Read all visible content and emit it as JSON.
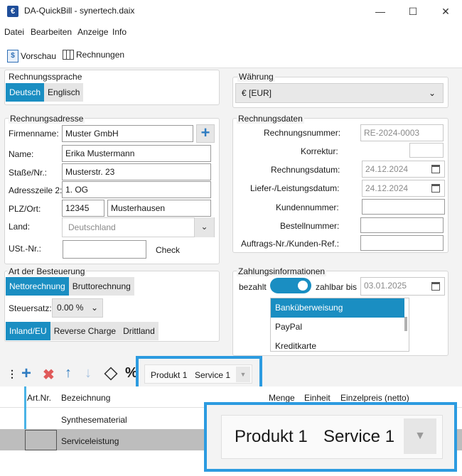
{
  "window": {
    "title": "DA-QuickBill - synertech.daix"
  },
  "menu": [
    "Datei",
    "Bearbeiten",
    "Anzeige",
    "Info"
  ],
  "toolbar": {
    "preview": "Vorschau",
    "invoices": "Rechnungen"
  },
  "language": {
    "title": "Rechnungssprache",
    "options": [
      "Deutsch",
      "Englisch"
    ],
    "selected": "Deutsch"
  },
  "currency": {
    "title": "Währung",
    "value": "€ [EUR]"
  },
  "address": {
    "title": "Rechnungsadresse",
    "company_label": "Firmenname:",
    "company": "Muster GmbH",
    "name_label": "Name:",
    "name": "Erika Mustermann",
    "street_label": "Staße/Nr.:",
    "street": "Musterstr. 23",
    "line2_label": "Adresszeile 2:",
    "line2": "1. OG",
    "zip_city_label": "PLZ/Ort:",
    "zip": "12345",
    "city": "Musterhausen",
    "country_label": "Land:",
    "country": "Deutschland",
    "vat_label": "USt.-Nr.:",
    "vat": "",
    "check": "Check"
  },
  "invoice": {
    "title": "Rechnungsdaten",
    "number_label": "Rechnungsnummer:",
    "number": "RE-2024-0003",
    "correction_label": "Korrektur:",
    "date_label": "Rechnungsdatum:",
    "date": "24.12.2024",
    "delivery_label": "Liefer-/Leistungsdatum:",
    "delivery": "24.12.2024",
    "customer_label": "Kundennummer:",
    "order_label": "Bestellnummer:",
    "ref_label": "Auftrags-Nr./Kunden-Ref.:"
  },
  "taxation": {
    "title": "Art der Besteuerung",
    "modes": [
      "Nettorechnung",
      "Bruttorechnung"
    ],
    "mode_selected": "Nettorechnung",
    "rate_label": "Steuersatz:",
    "rate": "0.00 %",
    "regions": [
      "Inland/EU",
      "Reverse Charge",
      "Drittland"
    ],
    "region_selected": "Inland/EU"
  },
  "payment": {
    "title": "Zahlungsinformationen",
    "paid_label": "bezahlt",
    "due_label": "zahlbar bis",
    "due": "03.01.2025",
    "methods": [
      "Banküberweisung",
      "PayPal",
      "Kreditkarte"
    ],
    "selected": "Banküberweisung"
  },
  "items": {
    "filter_tabs": [
      "Produkt 1",
      "Service 1"
    ],
    "percent": "%",
    "columns": [
      "Art.Nr.",
      "Bezeichnung",
      "Menge",
      "Einheit",
      "Einzelpreis (netto)"
    ],
    "rows": [
      {
        "art": "",
        "desc": "Synthesematerial"
      },
      {
        "art": "",
        "desc": "Serviceleistung"
      }
    ]
  },
  "colors": {
    "accent": "#1a8ec2",
    "highlight_border": "#2c9be0"
  }
}
